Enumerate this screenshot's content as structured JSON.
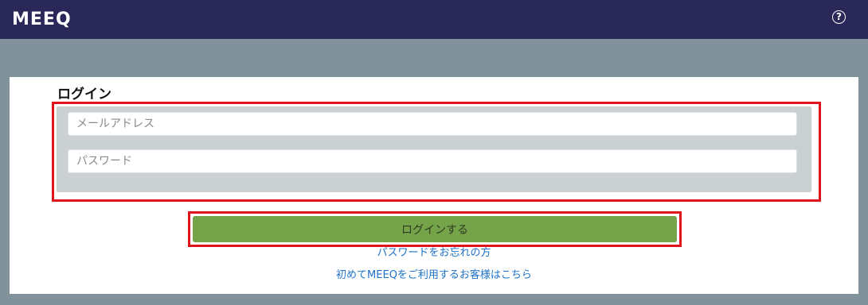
{
  "header": {
    "logo_text": "MEEQ",
    "help_symbol": "?",
    "icons": {
      "help": "question-circle-icon"
    }
  },
  "login": {
    "title": "ログイン",
    "email_placeholder": "メールアドレス",
    "password_placeholder": "パスワード",
    "submit_label": "ログインする",
    "forgot_password_link": "パスワードをお忘れの方",
    "first_time_link": "初めてMEEQをご利用するお客様はこちら"
  },
  "colors": {
    "header_bg": "#2a2759",
    "page_bg": "#82929a",
    "form_bg": "#cbd1d3",
    "button_bg": "#74a34a",
    "link": "#1e72c9",
    "highlight": "#e2141b"
  }
}
